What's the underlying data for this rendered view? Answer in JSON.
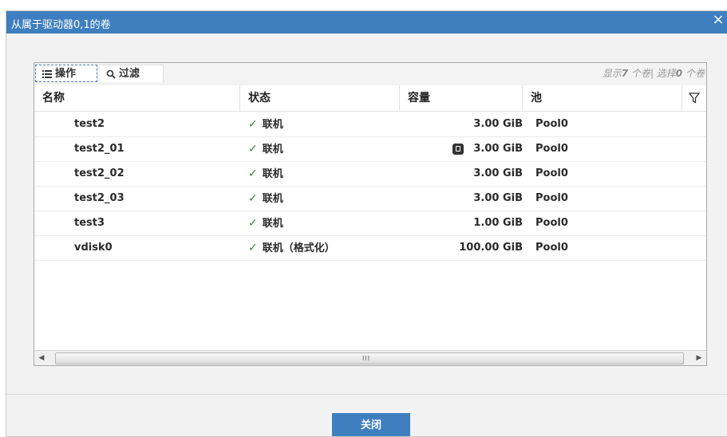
{
  "dialog": {
    "title": "从属于驱动器0,1的卷",
    "close_glyph": "×",
    "close_button_label": "关闭"
  },
  "toolbar": {
    "ops_label": "操作",
    "ops_icon": "list-icon",
    "filter_label": "过滤",
    "filter_icon": "search-icon",
    "summary_prefix": "显示",
    "summary_shown": "7",
    "summary_mid": "个卷| 选择",
    "summary_selected": "0",
    "summary_suffix": "个卷"
  },
  "table": {
    "columns": [
      "名称",
      "状态",
      "容量",
      "池"
    ],
    "filter_icon": "funnel-icon",
    "rows": [
      {
        "name": "test2",
        "status": "联机",
        "capacity": "3.00 GiB",
        "pool": "Pool0",
        "has_disk_icon": false
      },
      {
        "name": "test2_01",
        "status": "联机",
        "capacity": "3.00 GiB",
        "pool": "Pool0",
        "has_disk_icon": true
      },
      {
        "name": "test2_02",
        "status": "联机",
        "capacity": "3.00 GiB",
        "pool": "Pool0",
        "has_disk_icon": false
      },
      {
        "name": "test2_03",
        "status": "联机",
        "capacity": "3.00 GiB",
        "pool": "Pool0",
        "has_disk_icon": false
      },
      {
        "name": "test3",
        "status": "联机",
        "capacity": "1.00 GiB",
        "pool": "Pool0",
        "has_disk_icon": false
      },
      {
        "name": "vdisk0",
        "status": "联机（格式化）",
        "capacity": "100.00 GiB",
        "pool": "Pool0",
        "has_disk_icon": false
      }
    ],
    "status_icon": "check-icon"
  },
  "scrollbar": {
    "left_arrow": "◀",
    "right_arrow": "▶",
    "grip": "III"
  },
  "colors": {
    "accent": "#3f7fbf",
    "status_ok": "#2e8a2e"
  }
}
